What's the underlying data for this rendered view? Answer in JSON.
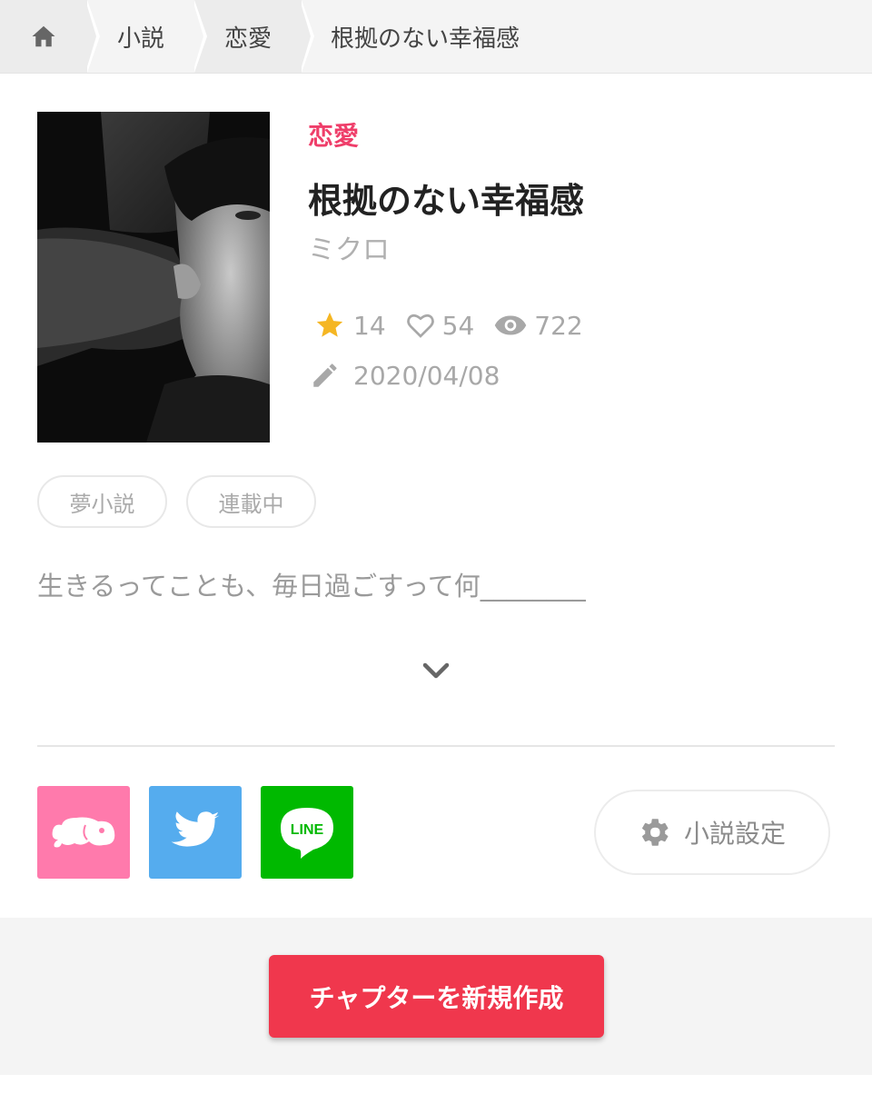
{
  "breadcrumb": {
    "home_icon": "home-icon",
    "items": [
      "小説",
      "恋愛",
      "根拠のない幸福感"
    ]
  },
  "novel": {
    "genre": "恋愛",
    "title": "根拠のない幸福感",
    "author": "ミクロ",
    "stats": {
      "stars": "14",
      "likes": "54",
      "views": "722"
    },
    "updated": "2020/04/08",
    "tags": [
      "夢小説",
      "連載中"
    ],
    "summary": "生きるってことも、毎日過ごすって何________"
  },
  "share": {
    "estar_icon": "elephant-icon",
    "twitter_icon": "twitter-bird-icon",
    "line_label": "LINE"
  },
  "settings_label": "小説設定",
  "new_chapter_label": "チャプターを新規作成",
  "colors": {
    "accent": "#ef3e6a",
    "button": "#f0374d",
    "star": "#f5b623",
    "twitter": "#55acee",
    "line": "#00b900",
    "estar": "#ff7aac"
  }
}
